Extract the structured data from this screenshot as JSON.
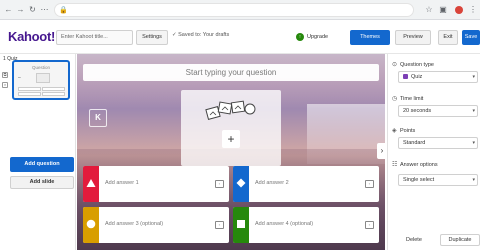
{
  "browser": {
    "back_icon": "back-arrow-icon",
    "url": "",
    "bookmark_icon": "star-icon",
    "extension_icon": "extension-icon"
  },
  "header": {
    "logo": "Kahoot!",
    "title_placeholder": "Enter Kahoot title...",
    "settings_label": "Settings",
    "saved_status": "✓ Saved to: Your drafts",
    "upgrade_label": "Upgrade",
    "themes_label": "Themes",
    "preview_label": "Preview",
    "exit_label": "Exit",
    "save_label": "Save",
    "accent_color": "#1368ce",
    "logo_color": "#46178f"
  },
  "sidebar": {
    "slide_number": "1 Quiz",
    "thumb_title": "Question",
    "add_question_label": "Add question",
    "add_slide_label": "Add slide"
  },
  "canvas": {
    "question_placeholder": "Start typing your question",
    "media_add": "+",
    "answers": [
      {
        "label": "Add answer 1",
        "color": "#e21b3c",
        "shape": "triangle"
      },
      {
        "label": "Add answer 2",
        "color": "#1368ce",
        "shape": "diamond"
      },
      {
        "label": "Add answer 3 (optional)",
        "color": "#d89e00",
        "shape": "circle"
      },
      {
        "label": "Add answer 4 (optional)",
        "color": "#26890c",
        "shape": "square"
      }
    ]
  },
  "right_panel": {
    "question_type_label": "Question type",
    "question_type_value": "Quiz",
    "time_limit_label": "Time limit",
    "time_limit_value": "20 seconds",
    "points_label": "Points",
    "points_value": "Standard",
    "answer_options_label": "Answer options",
    "answer_options_value": "Single select",
    "delete_label": "Delete",
    "duplicate_label": "Duplicate"
  }
}
